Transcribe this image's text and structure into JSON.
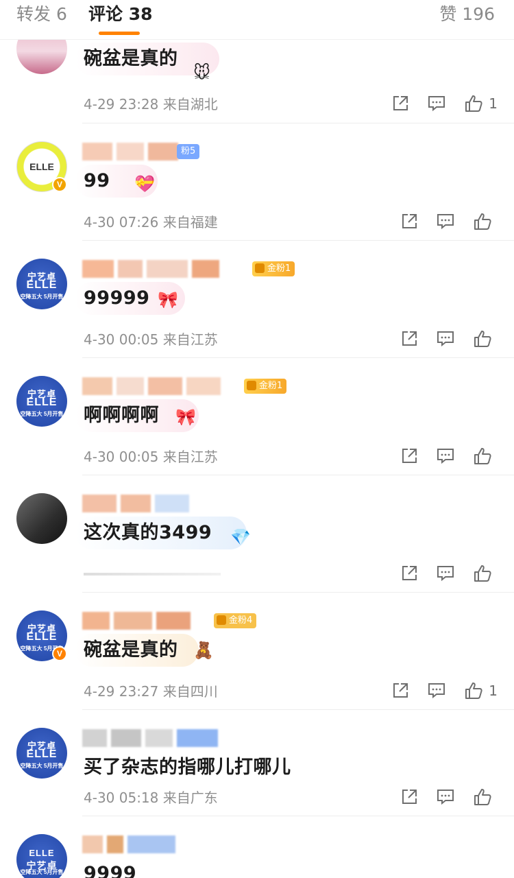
{
  "tabs": {
    "repost": "转发 6",
    "comment": "评论 38",
    "likes": "赞 196"
  },
  "accent_color": "#ff8200",
  "comments": [
    {
      "text": "碗盆是真的",
      "time": "4-29 23:28",
      "location": "来自湖北",
      "likes": "1",
      "avatar": "pink-avatar",
      "badge": ""
    },
    {
      "text": "99",
      "time": "4-30 07:26",
      "location": "来自福建",
      "likes": "",
      "avatar": "kitty-avatar",
      "badge": "粉5"
    },
    {
      "text": "99999",
      "time": "4-30 00:05",
      "location": "来自江苏",
      "likes": "",
      "avatar": "blue-avatar",
      "badge": "金粉1"
    },
    {
      "text": "啊啊啊啊",
      "time": "4-30 00:05",
      "location": "来自江苏",
      "likes": "",
      "avatar": "blue-avatar",
      "badge": "金粉1"
    },
    {
      "text": "这次真的3499",
      "time": "",
      "location": "",
      "likes": "",
      "avatar": "photo-avatar",
      "badge": ""
    },
    {
      "text": "碗盆是真的",
      "time": "4-29 23:27",
      "location": "来自四川",
      "likes": "1",
      "avatar": "blue-avatar",
      "badge": "金粉4"
    },
    {
      "text": "买了杂志的指哪儿打哪儿",
      "time": "4-30 05:18",
      "location": "来自广东",
      "likes": "",
      "avatar": "blue-avatar",
      "badge": ""
    },
    {
      "text": "9999",
      "time": "",
      "location": "",
      "likes": "",
      "avatar": "blue-avatar",
      "badge": ""
    }
  ],
  "avatar_text": {
    "line1": "宁艺卓",
    "line2": "ELLE",
    "line3": "空降五大 5月开售"
  },
  "icons": {
    "share": "share-icon",
    "reply": "reply-icon",
    "like": "thumb-up-icon"
  }
}
